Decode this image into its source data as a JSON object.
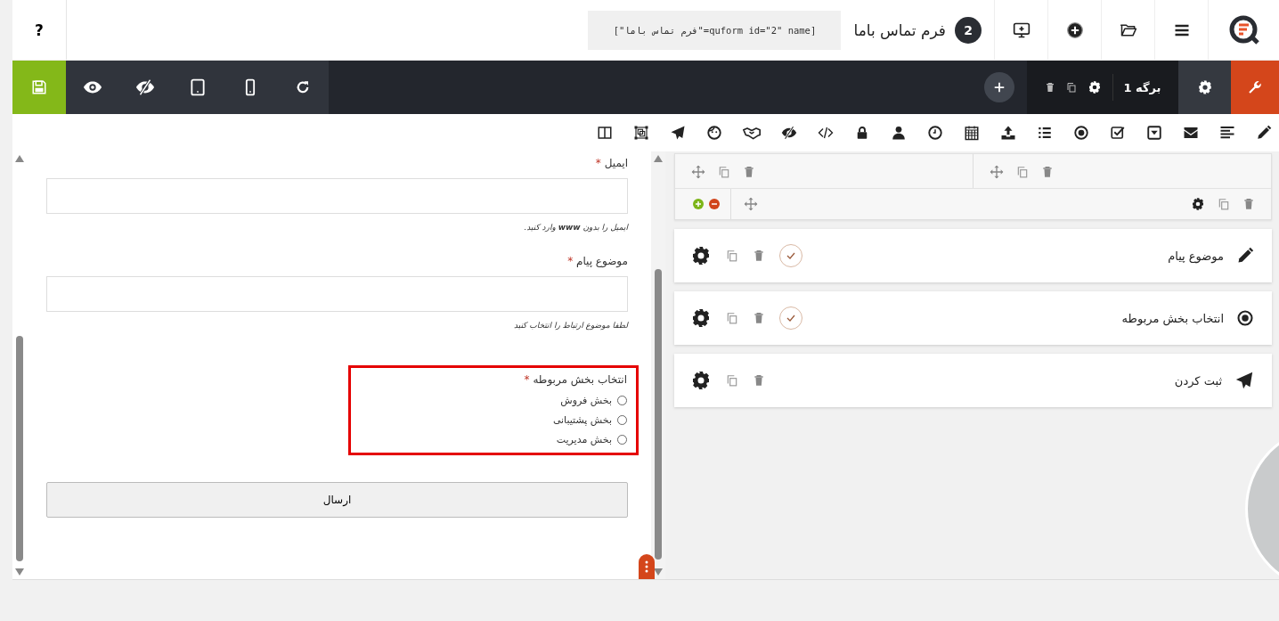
{
  "topbar": {
    "help": "?",
    "shortcode": "[quform id=\"2\" name=\"فرم تماس باما\"]",
    "form_title": "فرم تماس باما",
    "form_id": "2"
  },
  "toolbar": {
    "page_tab": "برگه 1"
  },
  "preview": {
    "fields": [
      {
        "kind": "text",
        "label": "ایمیل",
        "mark": "*",
        "hint": "ایمیل را بدون **www** وارد کنید."
      },
      {
        "kind": "text",
        "label": "موضوع پیام",
        "mark": "*",
        "hint": "لطفا موضوع ارتباط را انتخاب کنید"
      },
      {
        "kind": "radio",
        "label": "انتخاب بخش مربوطه",
        "mark": "*",
        "highlighted": true,
        "options": [
          {
            "label": "بخش فروش",
            "selected": false
          },
          {
            "label": "بخش پشتیبانی",
            "selected": false
          },
          {
            "label": "بخش مدیریت",
            "selected": false
          }
        ]
      }
    ],
    "submit": "ارسال"
  },
  "builder": {
    "elements": [
      {
        "kind": "text",
        "label": "موضوع پیام",
        "required": true
      },
      {
        "kind": "radio",
        "label": "انتخاب بخش مربوطه",
        "required": true
      },
      {
        "kind": "submit",
        "label": "ثبت کردن",
        "required": false
      }
    ]
  }
}
